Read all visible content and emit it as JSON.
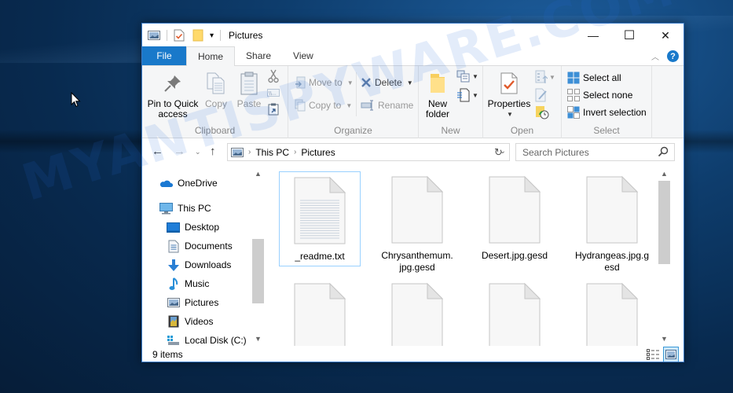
{
  "window": {
    "title": "Pictures",
    "controls": {
      "minimize": "—",
      "maximize": "☐",
      "close": "✕"
    }
  },
  "ribbon_tabs": [
    {
      "label": "File",
      "active": false
    },
    {
      "label": "Home",
      "active": true
    },
    {
      "label": "Share",
      "active": false
    },
    {
      "label": "View",
      "active": false
    }
  ],
  "ribbon": {
    "clipboard": {
      "label": "Clipboard",
      "pin": "Pin to Quick access",
      "pin_line1": "Pin to Quick",
      "pin_line2": "access",
      "copy": "Copy",
      "paste": "Paste"
    },
    "organize": {
      "label": "Organize",
      "move_to": "Move to",
      "copy_to": "Copy to",
      "delete": "Delete",
      "rename": "Rename"
    },
    "new": {
      "label": "New",
      "new_folder_line1": "New",
      "new_folder_line2": "folder"
    },
    "open": {
      "label": "Open",
      "properties": "Properties"
    },
    "select": {
      "label": "Select",
      "select_all": "Select all",
      "select_none": "Select none",
      "invert_selection": "Invert selection"
    }
  },
  "address": {
    "crumbs": [
      "This PC",
      "Pictures"
    ],
    "search_placeholder": "Search Pictures"
  },
  "nav_pane": {
    "items": [
      {
        "label": "OneDrive",
        "icon": "onedrive-icon",
        "indent": 0
      },
      {
        "label": "This PC",
        "icon": "computer-icon",
        "indent": 0
      },
      {
        "label": "Desktop",
        "icon": "desktop-icon",
        "indent": 1
      },
      {
        "label": "Documents",
        "icon": "documents-icon",
        "indent": 1
      },
      {
        "label": "Downloads",
        "icon": "downloads-icon",
        "indent": 1
      },
      {
        "label": "Music",
        "icon": "music-icon",
        "indent": 1
      },
      {
        "label": "Pictures",
        "icon": "pictures-icon",
        "indent": 1
      },
      {
        "label": "Videos",
        "icon": "videos-icon",
        "indent": 1
      },
      {
        "label": "Local Disk (C:)",
        "icon": "drive-icon",
        "indent": 1
      }
    ]
  },
  "files": [
    {
      "name": "_readme.txt",
      "line1": "_readme.txt",
      "line2": "",
      "type": "text",
      "selected": true
    },
    {
      "name": "Chrysanthemum.jpg.gesd",
      "line1": "Chrysanthemum.",
      "line2": "jpg.gesd",
      "type": "blank",
      "selected": false
    },
    {
      "name": "Desert.jpg.gesd",
      "line1": "Desert.jpg.gesd",
      "line2": "",
      "type": "blank",
      "selected": false
    },
    {
      "name": "Hydrangeas.jpg.gesd",
      "line1": "Hydrangeas.jpg.g",
      "line2": "esd",
      "type": "blank",
      "selected": false
    },
    {
      "name": "",
      "line1": "",
      "line2": "",
      "type": "blank",
      "selected": false
    },
    {
      "name": "",
      "line1": "",
      "line2": "",
      "type": "blank",
      "selected": false
    },
    {
      "name": "",
      "line1": "",
      "line2": "",
      "type": "blank",
      "selected": false
    },
    {
      "name": "",
      "line1": "",
      "line2": "",
      "type": "blank",
      "selected": false
    }
  ],
  "status": {
    "item_count": "9 items"
  },
  "watermark": "MYANTISPYWARE.COM",
  "colors": {
    "accent": "#1979ca",
    "selection_border": "#99d1ff"
  }
}
